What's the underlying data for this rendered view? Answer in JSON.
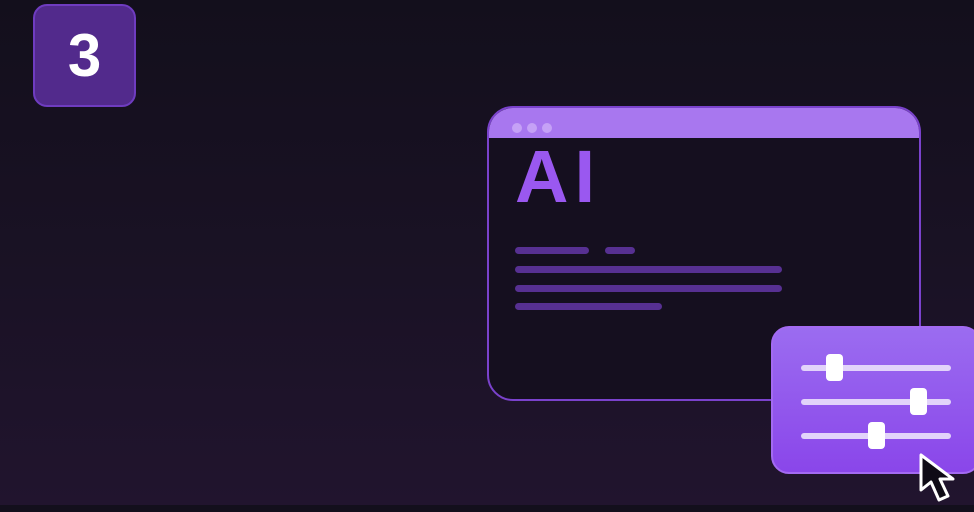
{
  "step": {
    "number": "3"
  },
  "window": {
    "logo_text": "AI",
    "titlebar_dots": 3
  },
  "sliders": [
    {
      "name": "slider-1",
      "value": 0.22
    },
    {
      "name": "slider-2",
      "value": 0.78
    },
    {
      "name": "slider-3",
      "value": 0.5
    }
  ],
  "icons": {
    "cursor": "mouse-pointer-icon"
  },
  "colors": {
    "background": "#16101f",
    "accent": "#9a58f0",
    "badge": "#522a8c",
    "titlebar": "#a877ef",
    "text_placeholder": "#573092",
    "slider_card": "#8a46ea"
  }
}
